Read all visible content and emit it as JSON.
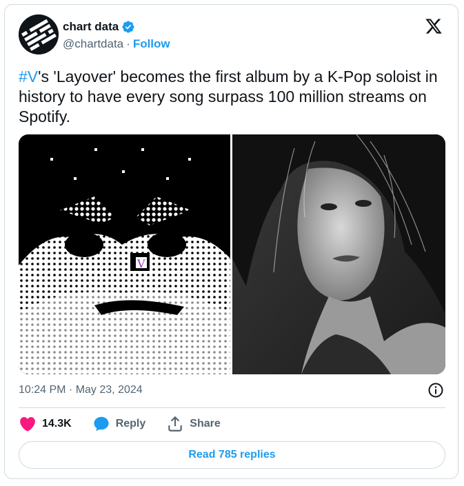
{
  "author": {
    "name": "chart data",
    "handle": "@chartdata",
    "separator": "·",
    "follow_label": "Follow"
  },
  "tweet": {
    "hashtag": "#V",
    "text": "'s 'Layover' becomes the first album by a K-Pop soloist in history to have every song surpass 100 million streams on Spotify."
  },
  "media": {
    "left_icon": "album-cover-pixel-art",
    "right_icon": "black-white-portrait-photo"
  },
  "meta": {
    "timestamp": "10:24 PM · May 23, 2024"
  },
  "actions": {
    "like_count": "14.3K",
    "reply_label": "Reply",
    "share_label": "Share"
  },
  "replies": {
    "label": "Read 785 replies"
  },
  "colors": {
    "accent": "#1d9bf0",
    "like": "#f91880",
    "border": "#cfd9de",
    "muted": "#536471"
  }
}
